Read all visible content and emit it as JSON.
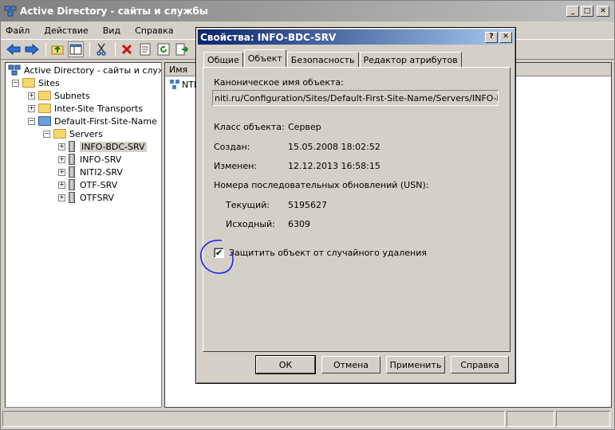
{
  "main_window": {
    "title": "Active Directory - сайты и службы",
    "menu": [
      "Файл",
      "Действие",
      "Вид",
      "Справка"
    ],
    "min": "_",
    "max": "□",
    "close": "✕"
  },
  "tree": {
    "root": "Active Directory - сайты и службы",
    "sites": "Sites",
    "subnets": "Subnets",
    "inter_site": "Inter-Site Transports",
    "default_site": "Default-First-Site-Name",
    "servers": "Servers",
    "server_items": [
      "INFO-BDC-SRV",
      "INFO-SRV",
      "NITI2-SRV",
      "OTF-SRV",
      "OTFSRV"
    ],
    "expand_minus": "−",
    "expand_plus": "+"
  },
  "list": {
    "column_name": "Имя",
    "row1": "NTD"
  },
  "dialog": {
    "title": "Свойства: INFO-BDC-SRV",
    "help_btn": "?",
    "close_btn": "✕",
    "tabs": [
      "Общие",
      "Объект",
      "Безопасность",
      "Редактор атрибутов"
    ],
    "canonical_label": "Каноническое имя объекта:",
    "canonical_value": "niti.ru/Configuration/Sites/Default-First-Site-Name/Servers/INFO-BDC-SRV",
    "class_label": "Класс объекта:",
    "class_value": "Сервер",
    "created_label": "Создан:",
    "created_value": "15.05.2008 18:02:52",
    "modified_label": "Изменен:",
    "modified_value": "12.12.2013 16:58:15",
    "usn_label": "Номера последовательных обновлений (USN):",
    "current_label": "Текущий:",
    "current_value": "5195627",
    "original_label": "Исходный:",
    "original_value": "6309",
    "protect_label": "Защитить объект от случайного удаления",
    "protect_checked": "✔",
    "buttons": {
      "ok": "ОК",
      "cancel": "Отмена",
      "apply": "Применить",
      "help": "Справка"
    }
  },
  "colors": {
    "annotation_circle": "#1a1aff",
    "active_title": "#0a246a"
  }
}
